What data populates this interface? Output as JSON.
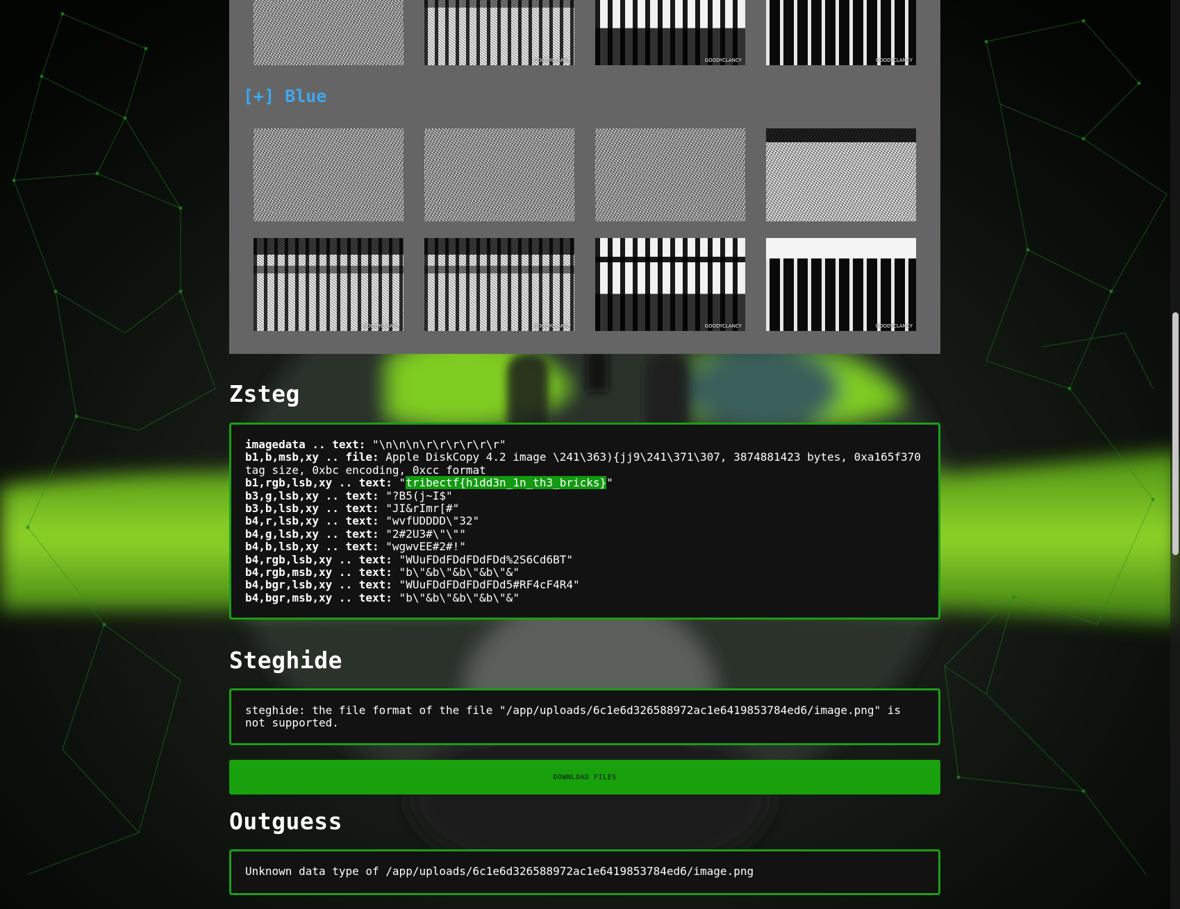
{
  "theme": {
    "accent": "#18a10c",
    "border": "#1c9e17",
    "highlight": "#129a10",
    "blue_label": "#3ea7ee",
    "panel": "#656565"
  },
  "gallery": {
    "blue_heading": "[+] Blue",
    "watermark": "GOODYCLANCY"
  },
  "zsteg": {
    "title": "Zsteg",
    "lines": [
      {
        "key": "imagedata .. text:",
        "value": " \"\\n\\n\\n\\r\\r\\r\\r\\r\\r\""
      },
      {
        "key": "b1,b,msb,xy .. file:",
        "value": " Apple DiskCopy 4.2 image \\241\\363){jj9\\241\\371\\307, 3874881423 bytes, 0xa165f370"
      },
      {
        "key": "",
        "value": "tag size, 0xbc encoding, 0xcc format"
      },
      {
        "key": "b1,rgb,lsb,xy .. text:",
        "value": " \"",
        "flag": "tribectf{h1dd3n_1n_th3_bricks}",
        "value_after": "\""
      },
      {
        "key": "b3,g,lsb,xy .. text:",
        "value": " \"?B5(j~I$\""
      },
      {
        "key": "b3,b,lsb,xy .. text:",
        "value": " \"JI&rImr[#\""
      },
      {
        "key": "b4,r,lsb,xy .. text:",
        "value": " \"wvfUDDDD\\\"32\""
      },
      {
        "key": "b4,g,lsb,xy .. text:",
        "value": " \"2#2U3#\\\"\\\"\""
      },
      {
        "key": "b4,b,lsb,xy .. text:",
        "value": " \"wgwvEE#2#!\""
      },
      {
        "key": "b4,rgb,lsb,xy .. text:",
        "value": " \"WUuFDdFDdFDdFDd%2S6Cd6BT\""
      },
      {
        "key": "b4,rgb,msb,xy .. text:",
        "value": " \"b\\\"&b\\\"&b\\\"&b\\\"&\""
      },
      {
        "key": "b4,bgr,lsb,xy .. text:",
        "value": " \"WUuFDdFDdFDdFDd5#RF4cF4R4\""
      },
      {
        "key": "b4,bgr,msb,xy .. text:",
        "value": " \"b\\\"&b\\\"&b\\\"&b\\\"&\""
      }
    ]
  },
  "steghide": {
    "title": "Steghide",
    "output": "steghide: the file format of the file \"/app/uploads/6c1e6d326588972ac1e6419853784ed6/image.png\" is not supported."
  },
  "download": {
    "label": "DOWNLOAD FILES"
  },
  "outguess": {
    "title": "Outguess",
    "output": "Unknown data type of /app/uploads/6c1e6d326588972ac1e6419853784ed6/image.png"
  }
}
